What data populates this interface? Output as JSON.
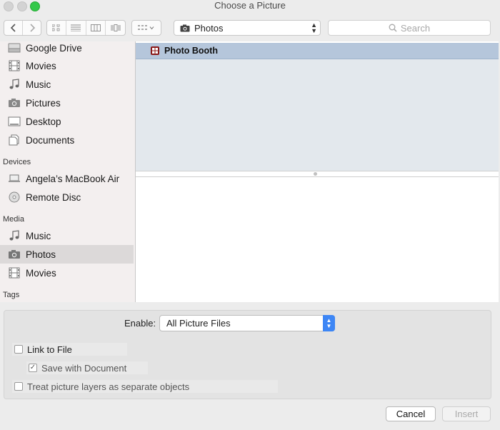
{
  "window": {
    "title": "Choose a Picture"
  },
  "toolbar": {
    "location": "Photos",
    "search_placeholder": "Search"
  },
  "sidebar": {
    "favorites": [
      {
        "label": "Google Drive",
        "icon": "drive-icon"
      },
      {
        "label": "Movies",
        "icon": "film-icon"
      },
      {
        "label": "Music",
        "icon": "music-note-icon"
      },
      {
        "label": "Pictures",
        "icon": "camera-icon"
      },
      {
        "label": "Desktop",
        "icon": "desktop-icon"
      },
      {
        "label": "Documents",
        "icon": "document-icon"
      }
    ],
    "devices_header": "Devices",
    "devices": [
      {
        "label": "Angela’s MacBook Air",
        "icon": "laptop-icon"
      },
      {
        "label": "Remote Disc",
        "icon": "disc-icon"
      }
    ],
    "media_header": "Media",
    "media": [
      {
        "label": "Music",
        "icon": "music-note-icon"
      },
      {
        "label": "Photos",
        "icon": "camera-icon",
        "selected": true
      },
      {
        "label": "Movies",
        "icon": "film-icon"
      }
    ],
    "tags_header": "Tags"
  },
  "browser": {
    "items": [
      {
        "label": "Photo Booth",
        "icon": "photo-booth-icon",
        "selected": true
      }
    ]
  },
  "options": {
    "enable_label": "Enable:",
    "enable_value": "All Picture Files",
    "link_to_file": {
      "label": "Link to File",
      "checked": false
    },
    "save_with_document": {
      "label": "Save with Document",
      "checked": true,
      "enabled": false
    },
    "treat_layers": {
      "label": "Treat picture layers as separate objects",
      "checked": false,
      "enabled": false
    }
  },
  "buttons": {
    "cancel": "Cancel",
    "insert": "Insert"
  },
  "colors": {
    "accent": "#3d86f5",
    "selection": "#b5c6db",
    "sidebar_bg": "#f3efef"
  }
}
